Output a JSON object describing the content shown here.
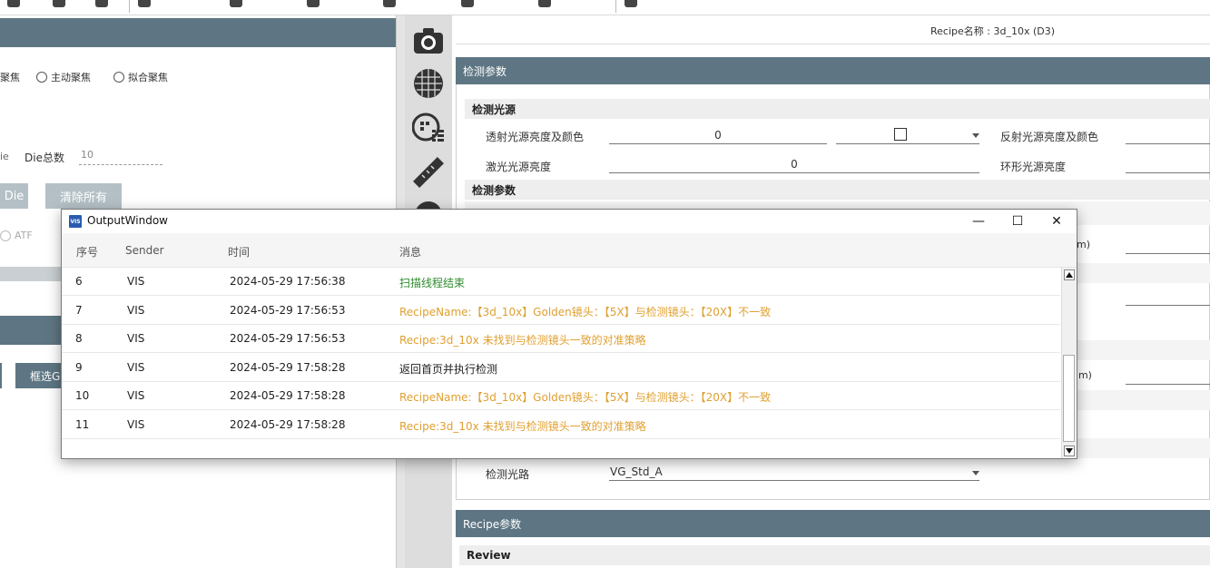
{
  "toolbar": {
    "items": [
      "",
      "",
      "",
      "",
      "",
      "",
      "",
      ""
    ]
  },
  "left_panel": {
    "radio_1": "聚焦",
    "radio_2": "主动聚焦",
    "radio_3": "拟合聚焦",
    "die_prefix": "ie",
    "die_total_label": "Die总数",
    "die_total_value": "10",
    "btn_die": "Die",
    "btn_clear_all": "清除所有",
    "atf_label": "ATF",
    "btn_select": "框选G"
  },
  "right_panel": {
    "recipe_name": "Recipe名称 : 3d_10x (D3)",
    "section_inspection_params": "检测参数",
    "subhead_light": "检测光源",
    "transmit_label": "透射光源亮度及颜色",
    "transmit_value": "0",
    "reflect_label": "反射光源亮度及颜色",
    "laser_label": "激光光源亮度",
    "laser_value": "0",
    "ring_label": "环形光源亮度",
    "subhead_params": "检测参数",
    "unit_um_1": "m)",
    "unit_um_2": "um)",
    "optical_path_label": "检测光路",
    "optical_path_value": "VG_Std_A",
    "section_recipe_params": "Recipe参数",
    "subhead_review": "Review"
  },
  "output_window": {
    "logo_text": "VIS",
    "title": "OutputWindow",
    "minimize": "—",
    "maximize": "☐",
    "close": "✕",
    "columns": [
      "序号",
      "Sender",
      "时间",
      "消息"
    ],
    "rows": [
      {
        "id": "6",
        "sender": "VIS",
        "time": "2024-05-29 17:56:38",
        "message": "扫描线程结束",
        "level": "success"
      },
      {
        "id": "7",
        "sender": "VIS",
        "time": "2024-05-29 17:56:53",
        "message": "RecipeName:【3d_10x】Golden镜头：【5X】与检测镜头：【20X】不一致",
        "level": "warning"
      },
      {
        "id": "8",
        "sender": "VIS",
        "time": "2024-05-29 17:56:53",
        "message": "Recipe:3d_10x 未找到与检测镜头一致的对准策略",
        "level": "warning"
      },
      {
        "id": "9",
        "sender": "VIS",
        "time": "2024-05-29 17:58:28",
        "message": "返回首页并执行检测",
        "level": "info"
      },
      {
        "id": "10",
        "sender": "VIS",
        "time": "2024-05-29 17:58:28",
        "message": "RecipeName:【3d_10x】Golden镜头：【5X】与检测镜头：【20X】不一致",
        "level": "warning"
      },
      {
        "id": "11",
        "sender": "VIS",
        "time": "2024-05-29 17:58:28",
        "message": "Recipe:3d_10x 未找到与检测镜头一致的对准策略",
        "level": "warning"
      }
    ]
  },
  "colors": {
    "header_bg": "#5e7683",
    "success": "#2e8b2e",
    "warning": "#e0a030",
    "info": "#222222"
  }
}
